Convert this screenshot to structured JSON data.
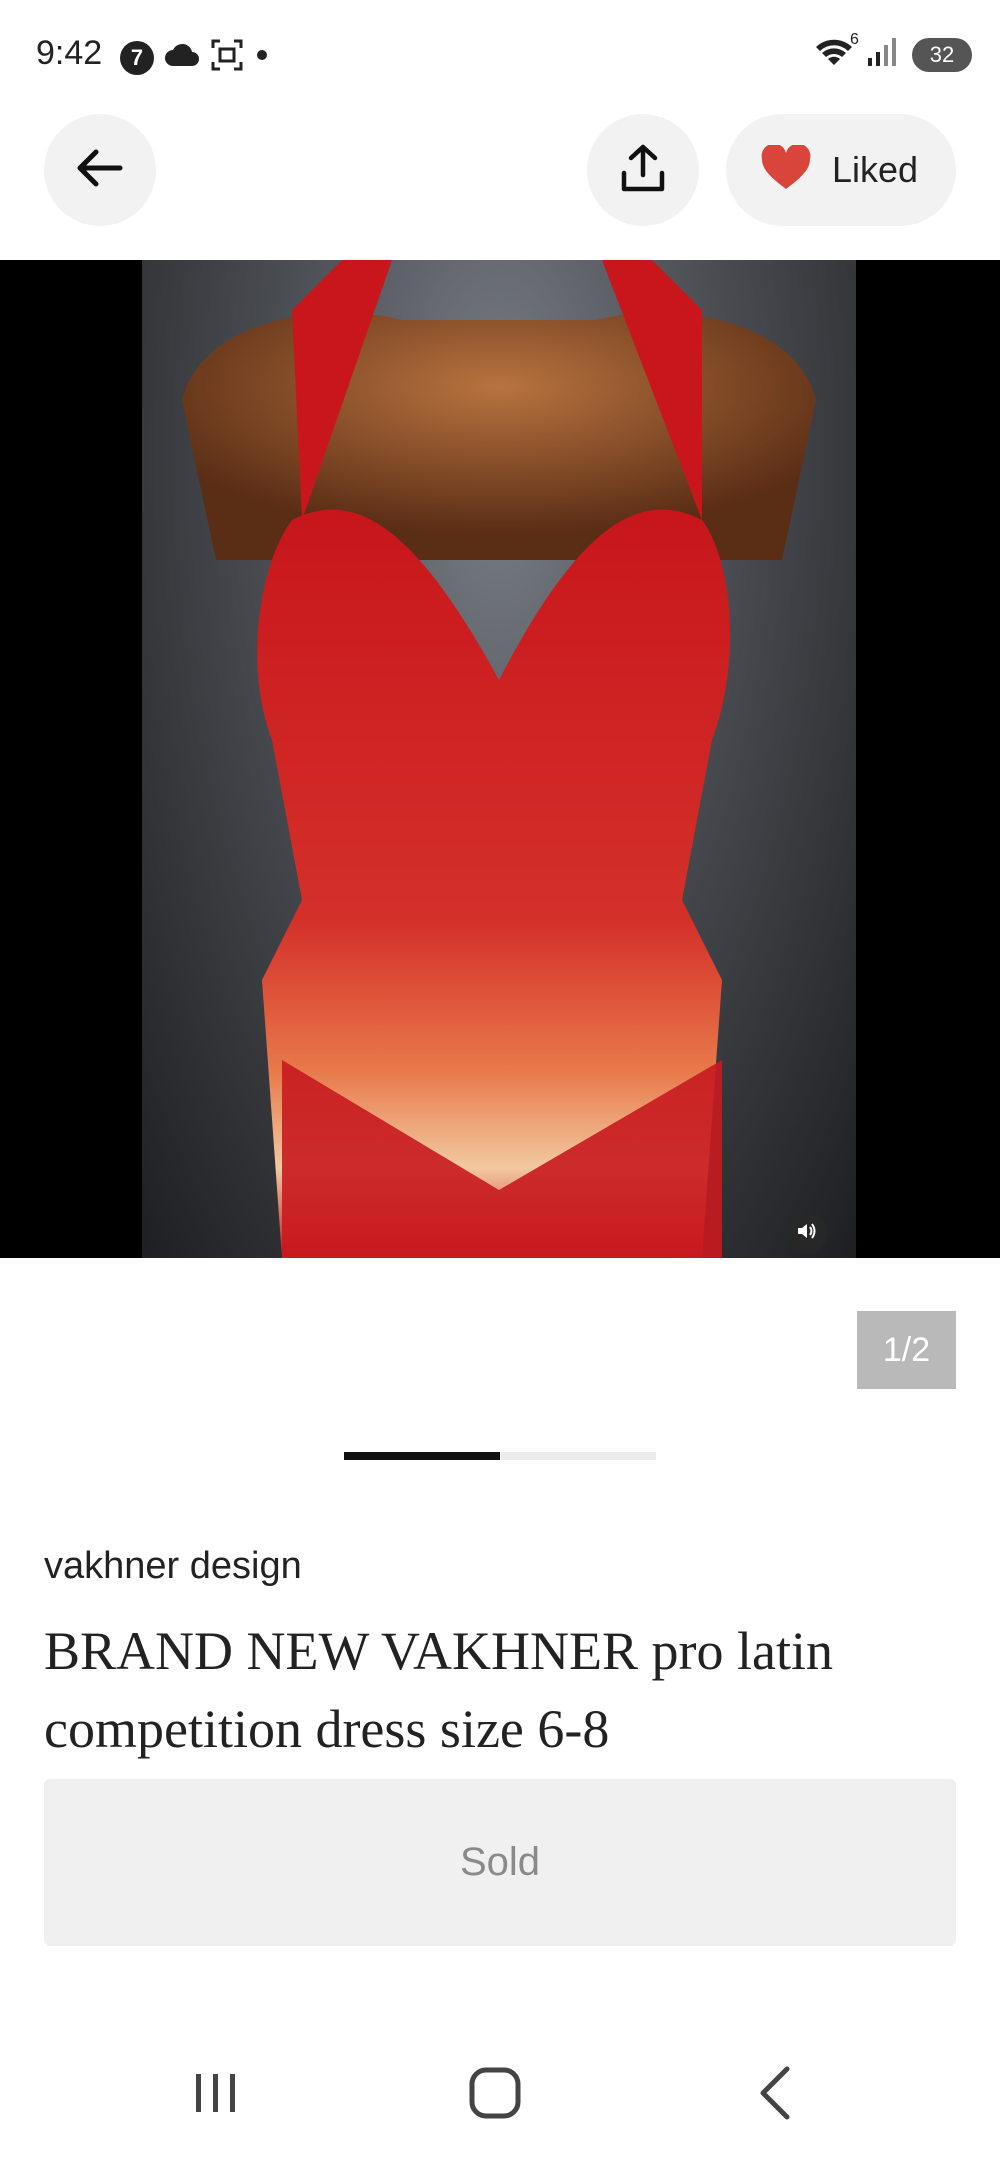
{
  "status_bar": {
    "time": "9:42",
    "left_icons": [
      "channel-7-icon",
      "cloud-icon",
      "screenshot-icon",
      "dot-icon"
    ],
    "right_icons": [
      "wifi-icon",
      "signal-icon",
      "battery-icon"
    ],
    "wifi_label": "6",
    "battery": "32"
  },
  "nav": {
    "liked_label": "Liked",
    "accent_color": "#d9453b"
  },
  "gallery": {
    "page_indicator": "1/2",
    "current_index": 1,
    "total": 2,
    "progress_fraction": 0.5
  },
  "product": {
    "brand": "vakhner design",
    "title": "BRAND NEW VAKHNER pro latin competition dress size 6-8",
    "status_label": "Sold"
  },
  "system_nav": {
    "icons": [
      "recent-apps-icon",
      "home-icon",
      "back-icon"
    ]
  }
}
